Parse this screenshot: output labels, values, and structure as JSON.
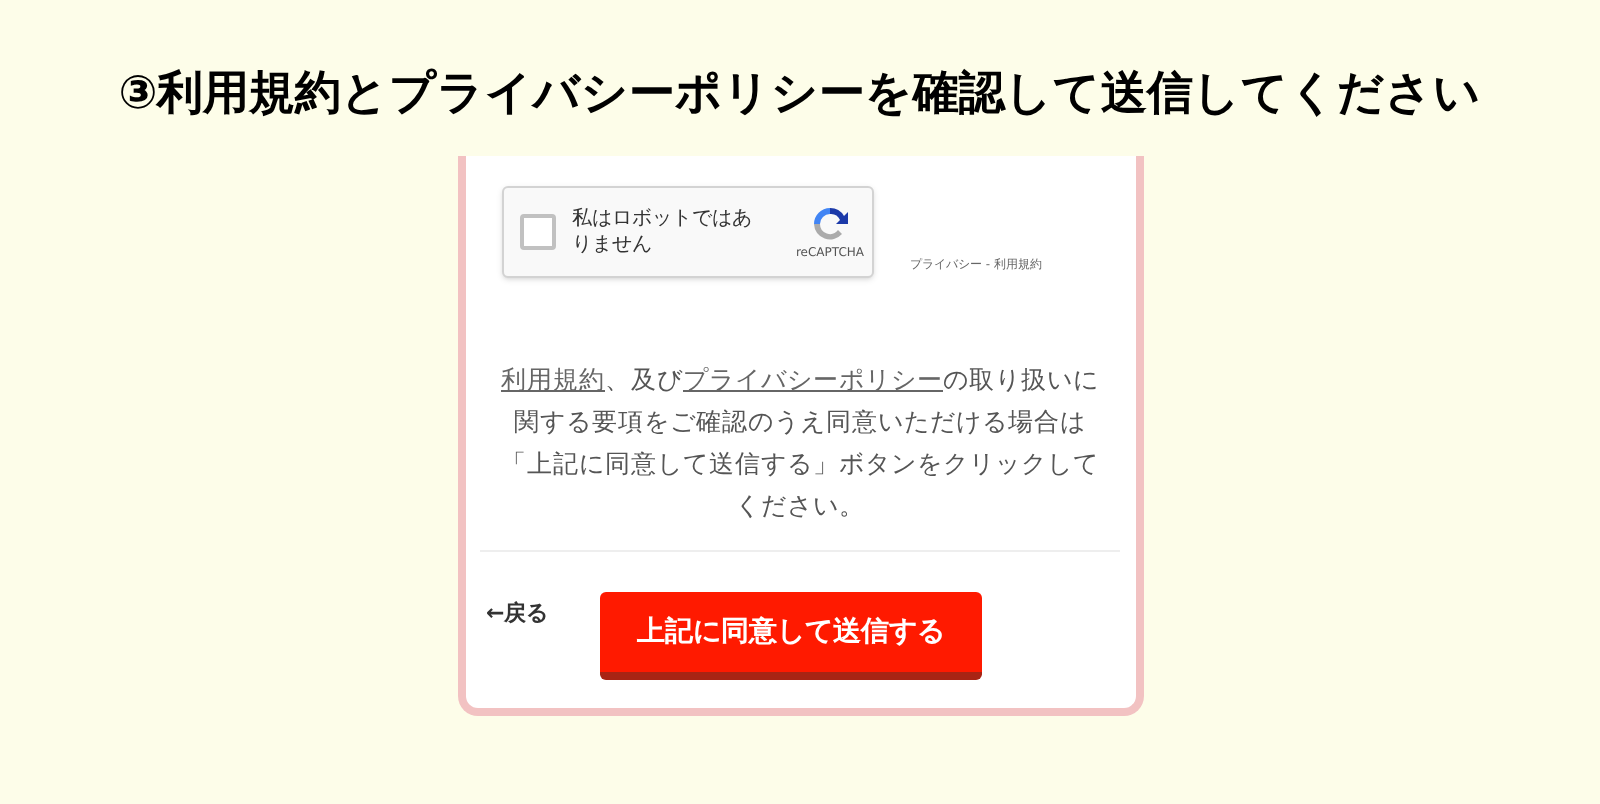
{
  "heading": "③利用規約とプライバシーポリシーを確認して送信してください",
  "captcha": {
    "checked": false,
    "label": "私はロボットではありません",
    "brand": "reCAPTCHA",
    "footer": "プライバシー - 利用規約"
  },
  "notice": [
    {
      "kind": "link",
      "text": "利用規約"
    },
    {
      "kind": "text",
      "text": "、及び"
    },
    {
      "kind": "link",
      "text": "プライバシーポリシー"
    },
    {
      "kind": "text",
      "text": "の取り扱いに関する要項をご確認のうえ同意いただける場合は「上記に同意して送信する」ボタンをクリックしてください。"
    }
  ],
  "back_link": "←戻る",
  "submit_button": "上記に同意して送信する"
}
